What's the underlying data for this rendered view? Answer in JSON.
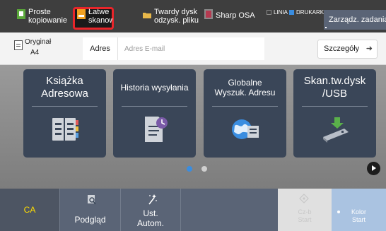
{
  "topbar": {
    "shortcuts": [
      {
        "label": "Proste\nkopiowanie",
        "icon": "copy-icon"
      },
      {
        "label": "Łatwe\nskanowanie",
        "icon": "easy-scan-icon"
      },
      {
        "label": "Twardy dysk\nodzysk. pliku",
        "icon": "folder-icon"
      },
      {
        "label": "Sharp OSA",
        "icon": "osa-icon"
      }
    ],
    "status": {
      "line": "LINIA",
      "printer": "DRUKARKA"
    },
    "manage_label": "Zarządz. zadaniami",
    "colors": {
      "bar": "#3e3e3e",
      "active_outline": "#e8252a",
      "status_line": "#5a5a5a",
      "status_printer": "#3a8de0"
    }
  },
  "bar2": {
    "original_label": "Oryginał",
    "original_size": "A4",
    "address_label": "Adres",
    "address_placeholder": "Adres E-mail",
    "details_label": "Szczegóły",
    "details_arrow": "➜"
  },
  "main": {
    "tiles": [
      {
        "title": "Książka\nAdresowa",
        "icon": "address-book-icon"
      },
      {
        "title": "Historia wysyłania",
        "icon": "send-history-icon"
      },
      {
        "title": "Globalne\nWyszuk. Adresu",
        "icon": "global-search-icon"
      },
      {
        "title": "Skan.tw.dysk\n/USB",
        "icon": "scan-to-usb-icon"
      }
    ],
    "page_indicator": {
      "current": 1,
      "total": 2
    },
    "accent": "#3a8de0"
  },
  "bottom": {
    "ca_label": "CA",
    "preview_label": "Podgląd",
    "auto_label": "Ust.\nAutom.",
    "mono_label": "Cz-b\nStart",
    "color_label": "Kolor\nStart",
    "colors": {
      "bar": "#5a6476",
      "ca_text": "#ffdd00",
      "color_start": "#aac3e1"
    }
  }
}
